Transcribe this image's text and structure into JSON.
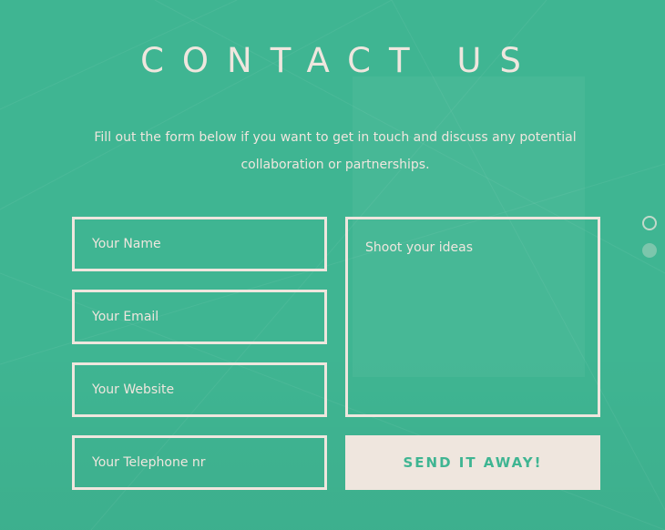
{
  "page": {
    "title": "CONTACT US",
    "intro": "Fill out the form below if you want to get in touch and discuss any potential collaboration or partnerships."
  },
  "form": {
    "name_placeholder": "Your Name",
    "email_placeholder": "Your Email",
    "website_placeholder": "Your Website",
    "telephone_placeholder": "Your Telephone nr",
    "message_placeholder": "Shoot your ideas",
    "submit_label": "SEND IT AWAY!"
  },
  "pagination": {
    "dots": 2,
    "active_index": 0
  },
  "colors": {
    "background": "#3fb592",
    "foreground": "#efe6de"
  }
}
